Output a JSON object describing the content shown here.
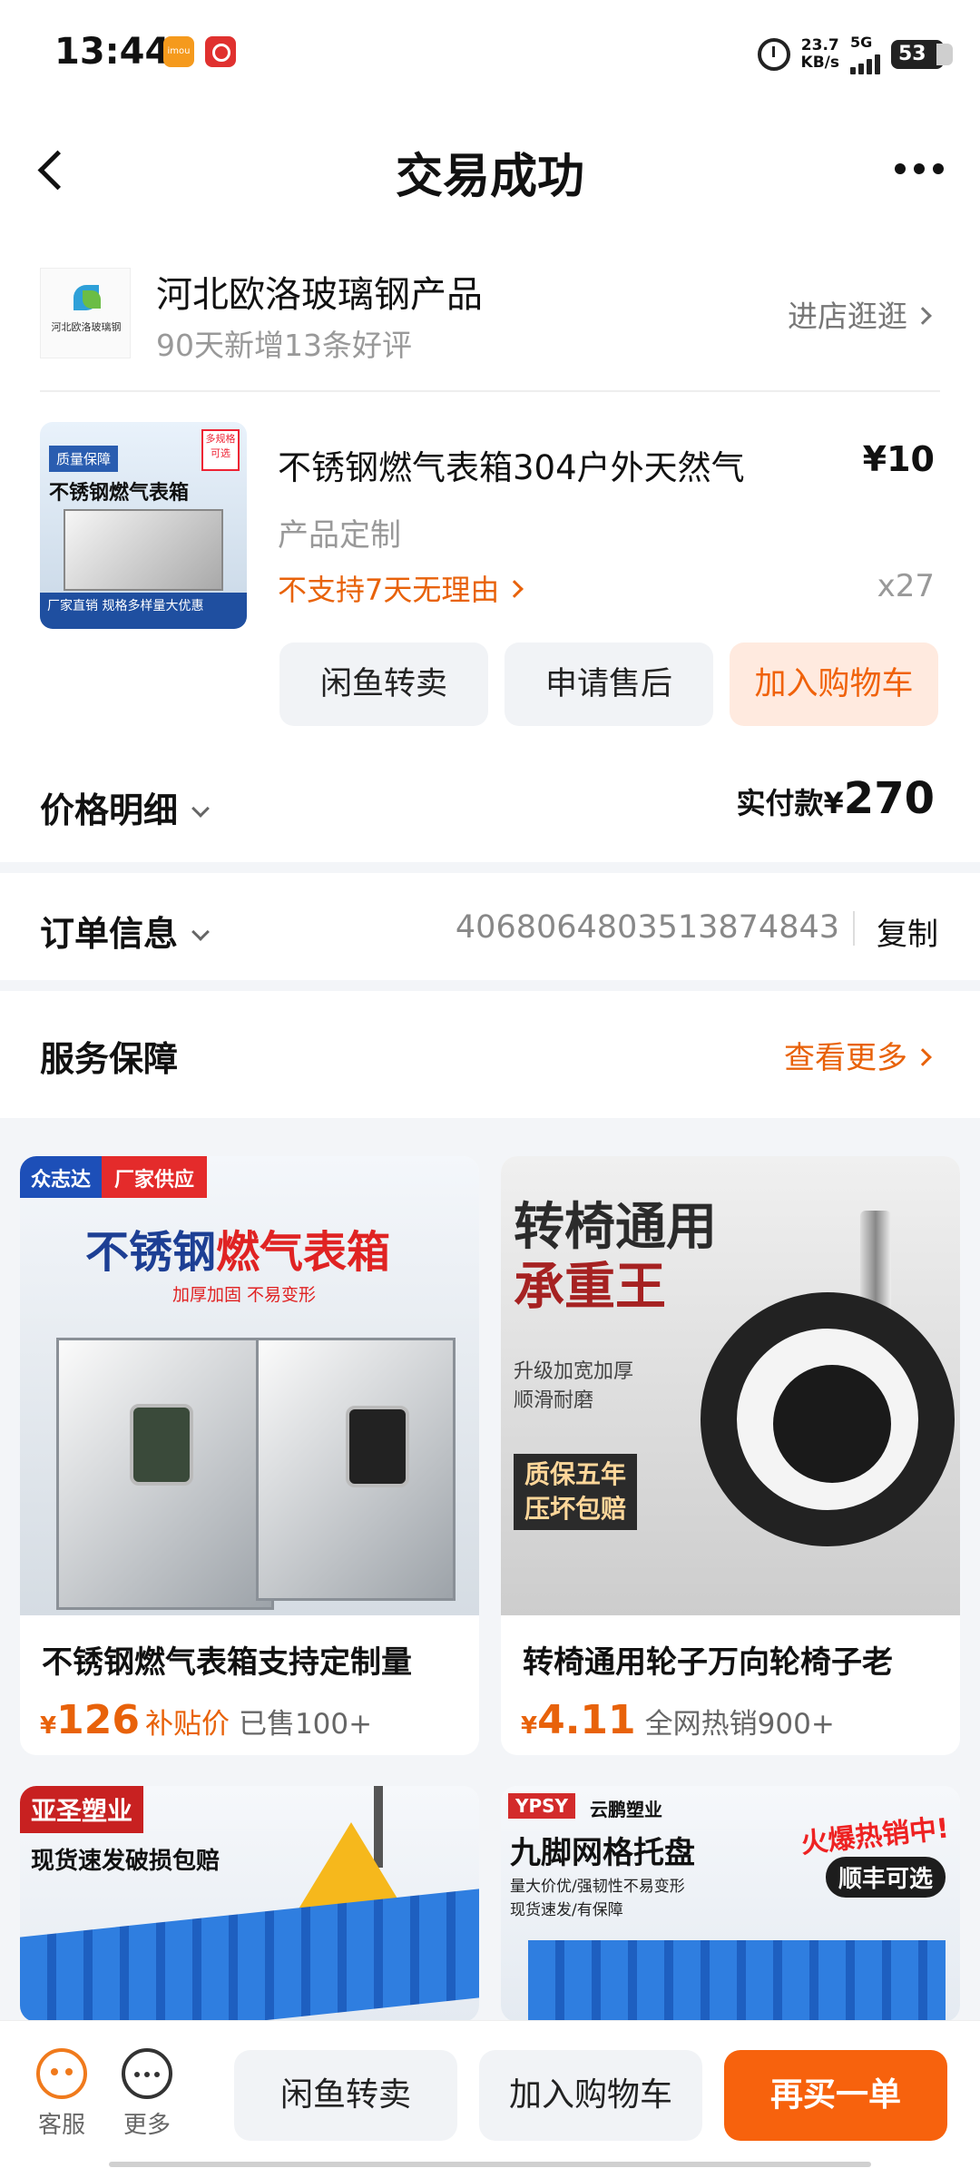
{
  "status_bar": {
    "time": "13:44",
    "app_icon_1": "imou",
    "net_speed_value": "23.7",
    "net_speed_unit": "KB/s",
    "network": "5G",
    "battery": "53",
    "icons": [
      "imou-app-icon",
      "bank-app-icon",
      "alarm-icon",
      "signal-icon",
      "battery-icon"
    ]
  },
  "header": {
    "title": "交易成功",
    "icons": [
      "back-arrow-icon",
      "more-dots-icon"
    ]
  },
  "shop": {
    "name": "河北欧洛玻璃钢产品",
    "subtitle": "90天新增13条好评",
    "enter_label": "进店逛逛",
    "logo_text": "河北欧洛玻璃钢"
  },
  "product": {
    "title": "不锈钢燃气表箱304户外天然气",
    "price": "¥10",
    "spec": "产品定制",
    "policy": "不支持7天无理由",
    "qty": "x27",
    "image_texts": {
      "badge_left": "质量保障",
      "badge_right": "多规格可选",
      "headline": "不锈钢燃气表箱",
      "footer": "厂家直销 规格多样量大优惠"
    },
    "actions": [
      "闲鱼转卖",
      "申请售后",
      "加入购物车"
    ]
  },
  "price_detail": {
    "label": "价格明细",
    "paid_label": "实付款¥",
    "paid_amount": "270"
  },
  "order_info": {
    "label": "订单信息",
    "order_no": "4068064803513874843",
    "copy_label": "复制"
  },
  "service": {
    "label": "服务保障",
    "more_label": "查看更多"
  },
  "recommendations": [
    {
      "title": "不锈钢燃气表箱支持定制量",
      "currency": "¥",
      "price": "126",
      "tag": "补贴价",
      "sold": "已售100+",
      "image_texts": {
        "brand": "众志达",
        "supply": "厂家供应",
        "headline_a": "不锈钢",
        "headline_b": "燃气表箱",
        "sub": "加厚加固 不易变形"
      }
    },
    {
      "title": "转椅通用轮子万向轮椅子老",
      "currency": "¥",
      "price": "4.11",
      "tag": "",
      "sold": "全网热销900+",
      "image_texts": {
        "headline_a": "转椅通用",
        "headline_b": "承重王",
        "sub_1": "升级加宽加厚",
        "sub_2": "顺滑耐磨",
        "promo_1": "质保五年",
        "promo_2": "压坏包赔"
      }
    },
    {
      "image_texts": {
        "brand": "亚圣塑业",
        "headline": "现货速发破损包赔"
      }
    },
    {
      "image_texts": {
        "brand": "YPSY",
        "brand_cn": "云鹏塑业",
        "headline": "九脚网格托盘",
        "line_1": "量大价优/强韧性不易变形",
        "line_2": "现货速发/有保障",
        "hot": "火爆热销中!",
        "sf": "顺丰可选"
      }
    }
  ],
  "bottom_bar": {
    "service_label": "客服",
    "more_label": "更多",
    "buttons": [
      "闲鱼转卖",
      "加入购物车",
      "再买一单"
    ]
  },
  "colors": {
    "accent": "#f7620d",
    "policy_orange": "#e8620a",
    "muted": "#999999"
  }
}
